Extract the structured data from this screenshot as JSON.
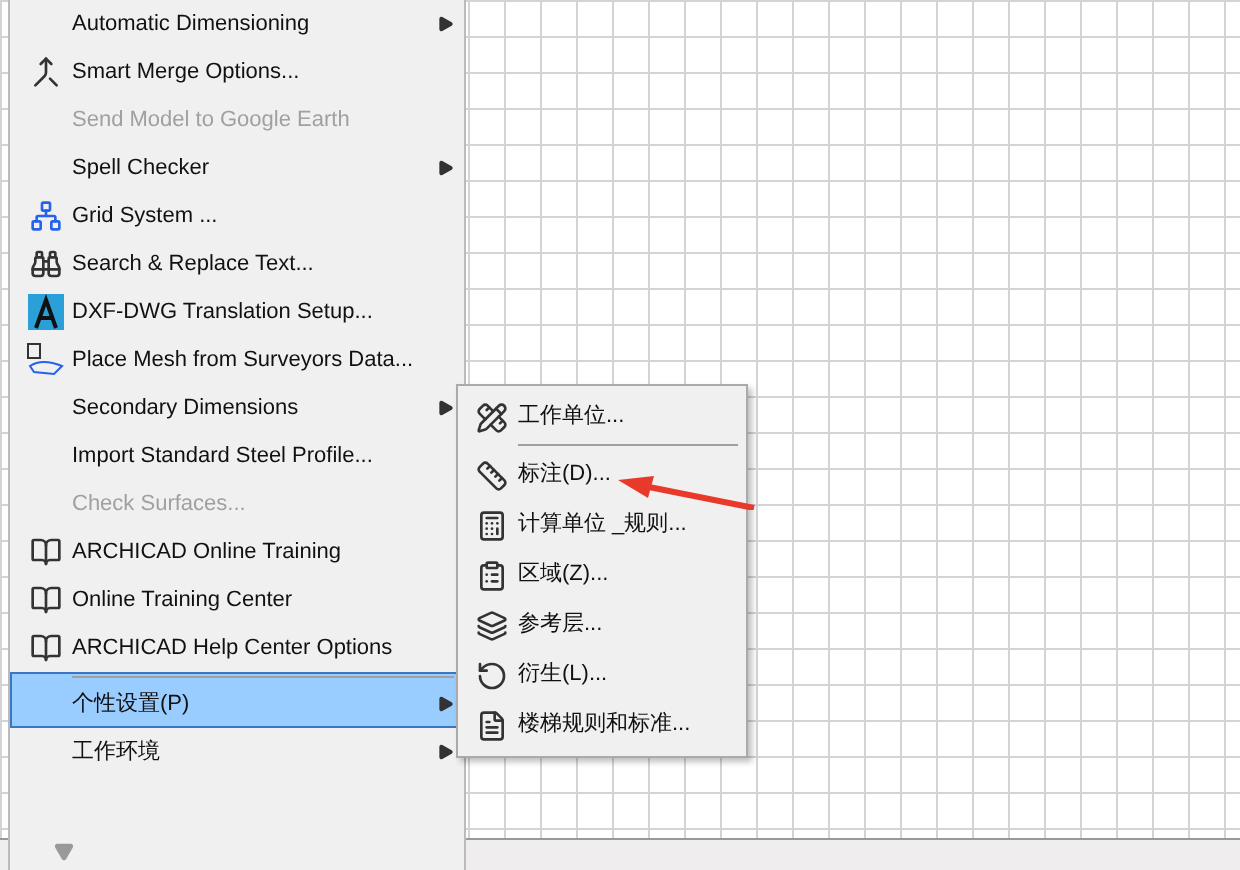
{
  "menu": {
    "items": [
      {
        "label": "Automatic Dimensioning",
        "disabled": false,
        "submenu": true,
        "selected": false,
        "separator_above": false
      },
      {
        "label": "Smart Merge Options...",
        "disabled": false,
        "submenu": false,
        "selected": false,
        "separator_above": false
      },
      {
        "label": "Send Model to Google Earth",
        "disabled": true,
        "submenu": false,
        "selected": false,
        "separator_above": false
      },
      {
        "label": "Spell Checker",
        "disabled": false,
        "submenu": true,
        "selected": false,
        "separator_above": false
      },
      {
        "label": "Grid System ...",
        "disabled": false,
        "submenu": false,
        "selected": false,
        "separator_above": false
      },
      {
        "label": "Search & Replace Text...",
        "disabled": false,
        "submenu": false,
        "selected": false,
        "separator_above": false
      },
      {
        "label": "DXF-DWG Translation Setup...",
        "disabled": false,
        "submenu": false,
        "selected": false,
        "separator_above": false
      },
      {
        "label": "Place Mesh from Surveyors Data...",
        "disabled": false,
        "submenu": false,
        "selected": false,
        "separator_above": false
      },
      {
        "label": "Secondary Dimensions",
        "disabled": false,
        "submenu": true,
        "selected": false,
        "separator_above": false
      },
      {
        "label": "Import Standard Steel Profile...",
        "disabled": false,
        "submenu": false,
        "selected": false,
        "separator_above": false
      },
      {
        "label": "Check Surfaces...",
        "disabled": true,
        "submenu": false,
        "selected": false,
        "separator_above": false
      },
      {
        "label": "ARCHICAD Online Training",
        "disabled": false,
        "submenu": false,
        "selected": false,
        "separator_above": false
      },
      {
        "label": "Online Training Center",
        "disabled": false,
        "submenu": false,
        "selected": false,
        "separator_above": false
      },
      {
        "label": "ARCHICAD Help Center Options",
        "disabled": false,
        "submenu": false,
        "selected": false,
        "separator_above": false
      },
      {
        "label": "个性设置(P)",
        "disabled": false,
        "submenu": true,
        "selected": true,
        "separator_above": true
      },
      {
        "label": "工作环境",
        "disabled": false,
        "submenu": true,
        "selected": false,
        "separator_above": false
      }
    ]
  },
  "submenu": {
    "items": [
      {
        "label": "工作单位...",
        "separator_above": false
      },
      {
        "label": "标注(D)...",
        "separator_above": true
      },
      {
        "label": "计算单位 _规则...",
        "separator_above": false
      },
      {
        "label": "区域(Z)...",
        "separator_above": false
      },
      {
        "label": "参考层...",
        "separator_above": false
      },
      {
        "label": "衍生(L)...",
        "separator_above": false
      },
      {
        "label": "楼梯规则和标准...",
        "separator_above": false
      }
    ]
  }
}
